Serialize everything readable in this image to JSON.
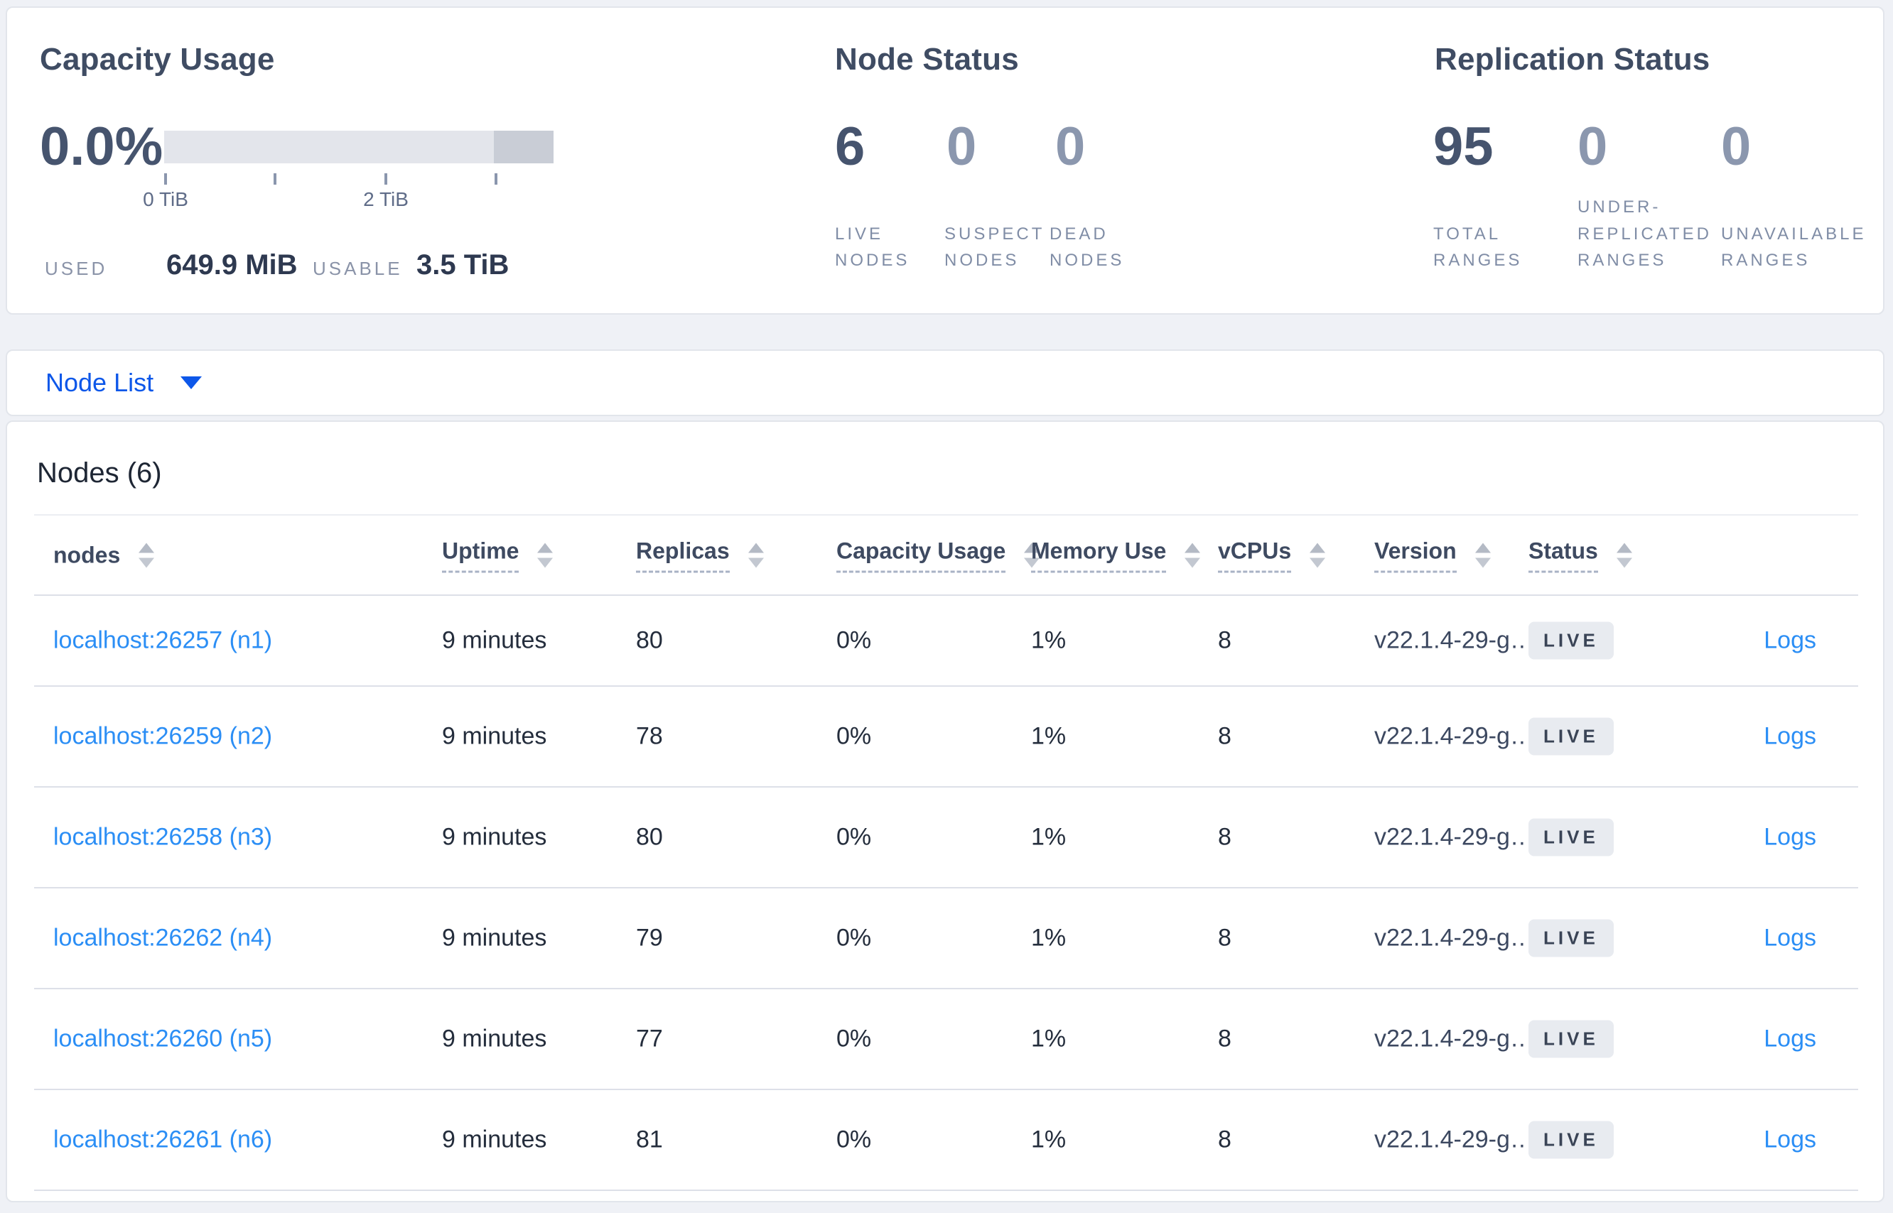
{
  "overview": {
    "capacity": {
      "title": "Capacity Usage",
      "percent": "0.0%",
      "tick_labels": [
        "0 TiB",
        "2 TiB"
      ],
      "used_label": "USED",
      "used_value": "649.9 MiB",
      "usable_label": "USABLE",
      "usable_value": "3.5 TiB"
    },
    "node_status": {
      "title": "Node Status",
      "stats": [
        {
          "value": "6",
          "label": "LIVE NODES"
        },
        {
          "value": "0",
          "label": "SUSPECT NODES"
        },
        {
          "value": "0",
          "label": "DEAD NODES"
        }
      ]
    },
    "replication_status": {
      "title": "Replication Status",
      "stats": [
        {
          "value": "95",
          "label": "TOTAL RANGES"
        },
        {
          "value": "0",
          "label": "UNDER-REPLICATED RANGES"
        },
        {
          "value": "0",
          "label": "UNAVAILABLE RANGES"
        }
      ]
    }
  },
  "view_selector": {
    "label": "Node List"
  },
  "nodes_section": {
    "title": "Nodes (6)",
    "headers": [
      {
        "label": "nodes",
        "underlined": false
      },
      {
        "label": "Uptime",
        "underlined": true
      },
      {
        "label": "Replicas",
        "underlined": true
      },
      {
        "label": "Capacity Usage",
        "underlined": true
      },
      {
        "label": "Memory Use",
        "underlined": true
      },
      {
        "label": "vCPUs",
        "underlined": true
      },
      {
        "label": "Version",
        "underlined": true
      },
      {
        "label": "Status",
        "underlined": true
      }
    ],
    "rows": [
      {
        "address": "localhost:26257 (n1)",
        "uptime": "9 minutes",
        "replicas": "80",
        "capacity": "0%",
        "memory": "1%",
        "vcpus": "8",
        "version": "v22.1.4-29-g…",
        "status": "LIVE",
        "logs": "Logs"
      },
      {
        "address": "localhost:26259 (n2)",
        "uptime": "9 minutes",
        "replicas": "78",
        "capacity": "0%",
        "memory": "1%",
        "vcpus": "8",
        "version": "v22.1.4-29-g…",
        "status": "LIVE",
        "logs": "Logs"
      },
      {
        "address": "localhost:26258 (n3)",
        "uptime": "9 minutes",
        "replicas": "80",
        "capacity": "0%",
        "memory": "1%",
        "vcpus": "8",
        "version": "v22.1.4-29-g…",
        "status": "LIVE",
        "logs": "Logs"
      },
      {
        "address": "localhost:26262 (n4)",
        "uptime": "9 minutes",
        "replicas": "79",
        "capacity": "0%",
        "memory": "1%",
        "vcpus": "8",
        "version": "v22.1.4-29-g…",
        "status": "LIVE",
        "logs": "Logs"
      },
      {
        "address": "localhost:26260 (n5)",
        "uptime": "9 minutes",
        "replicas": "77",
        "capacity": "0%",
        "memory": "1%",
        "vcpus": "8",
        "version": "v22.1.4-29-g…",
        "status": "LIVE",
        "logs": "Logs"
      },
      {
        "address": "localhost:26261 (n6)",
        "uptime": "9 minutes",
        "replicas": "81",
        "capacity": "0%",
        "memory": "1%",
        "vcpus": "8",
        "version": "v22.1.4-29-g…",
        "status": "LIVE",
        "logs": "Logs"
      }
    ]
  },
  "colors": {
    "accent_blue": "#0d57e9",
    "link_blue": "#2b8ef5",
    "stat_primary": "#46546e",
    "stat_secondary": "#8b97ae",
    "badge_bg": "#e8ebf0",
    "bar_light": "#e3e5eb",
    "bar_dark": "#c9cdd6"
  }
}
